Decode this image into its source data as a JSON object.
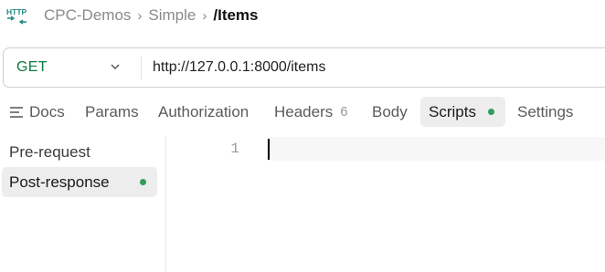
{
  "breadcrumb": {
    "icon": "http-icon",
    "items": [
      {
        "label": "CPC-Demos"
      },
      {
        "label": "Simple"
      },
      {
        "label": "/Items"
      }
    ]
  },
  "request": {
    "method": "GET",
    "url": "http://127.0.0.1:8000/items"
  },
  "tabs": [
    {
      "label": "Docs",
      "icon": "docs-icon"
    },
    {
      "label": "Params"
    },
    {
      "label": "Authorization"
    },
    {
      "label": "Headers",
      "count": "6"
    },
    {
      "label": "Body"
    },
    {
      "label": "Scripts",
      "active": true,
      "indicator": true
    },
    {
      "label": "Settings"
    }
  ],
  "scripts": {
    "items": [
      {
        "label": "Pre-request"
      },
      {
        "label": "Post-response",
        "active": true,
        "indicator": true
      }
    ]
  },
  "editor": {
    "line_numbers": [
      "1"
    ],
    "content": ""
  },
  "colors": {
    "method_get": "#0c7a3d",
    "indicator_dot": "#2f9e5a",
    "active_bg": "#ededed",
    "http_icon": "#1f8a83"
  }
}
